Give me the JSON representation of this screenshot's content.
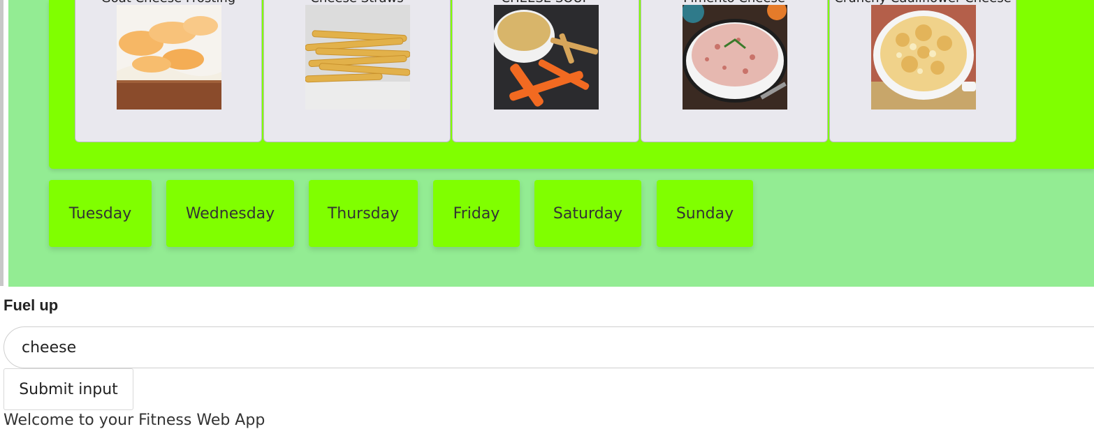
{
  "recipes": [
    {
      "title": "Goat Cheese Frosting",
      "image": "cake-with-peaches-photo"
    },
    {
      "title": "Cheese Straws",
      "image": "cheese-straws-photo"
    },
    {
      "title": "CHEESE SOUP",
      "image": "cheese-soup-with-carrots-photo"
    },
    {
      "title": "Pimento Cheese",
      "image": "pimento-cheese-dip-photo"
    },
    {
      "title": "Crunchy Cauliflower Cheese",
      "image": "cauliflower-cheese-casserole-photo"
    }
  ],
  "days": [
    "Tuesday",
    "Wednesday",
    "Thursday",
    "Friday",
    "Saturday",
    "Sunday"
  ],
  "form": {
    "label": "Fuel up",
    "input_value": "cheese",
    "submit_label": "Submit input"
  },
  "footer": {
    "text": "Welcome to your Fitness Web App"
  },
  "colors": {
    "panel": "#93ec93",
    "accent": "#80ff00",
    "card": "#e9e8ee"
  }
}
